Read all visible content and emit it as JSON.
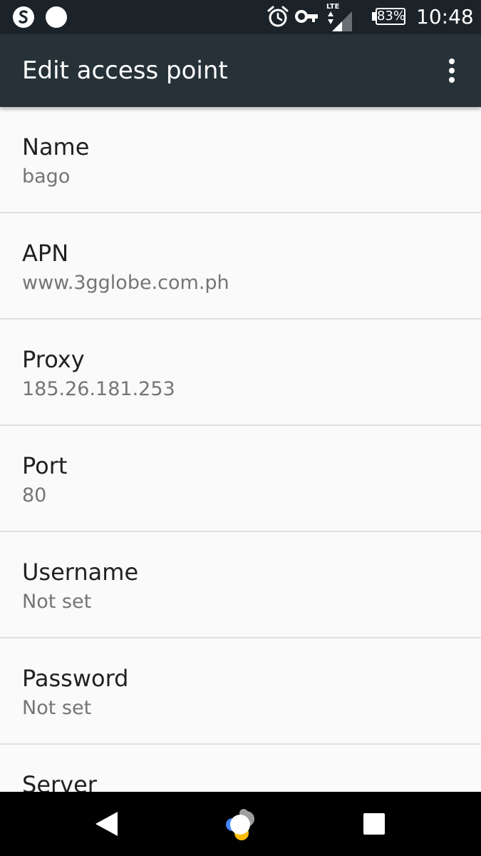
{
  "status_bar": {
    "left_icons": [
      "s-app-icon",
      "circle-app-icon"
    ],
    "right_icons": [
      "alarm-icon",
      "vpn-key-icon",
      "lte-signal-icon"
    ],
    "network_type": "LTE",
    "battery_percent": "83%",
    "time": "10:48"
  },
  "app_bar": {
    "title": "Edit access point",
    "menu_icon": "more-vert-icon"
  },
  "preferences": [
    {
      "title": "Name",
      "summary": "bago"
    },
    {
      "title": "APN",
      "summary": "www.3gglobe.com.ph"
    },
    {
      "title": "Proxy",
      "summary": "185.26.181.253"
    },
    {
      "title": "Port",
      "summary": "80"
    },
    {
      "title": "Username",
      "summary": "Not set"
    },
    {
      "title": "Password",
      "summary": "Not set"
    },
    {
      "title": "Server"
    }
  ],
  "nav_bar": {
    "back_icon": "back-triangle-icon",
    "home_icon": "assistant-home-icon",
    "recents_icon": "recents-square-icon",
    "colors": {
      "blue": "#4285f4",
      "yellow": "#fbbc05",
      "gray": "#9e9e9e"
    }
  },
  "colors": {
    "status_bar": "#1b2329",
    "app_bar": "#263238",
    "background": "#fafafa",
    "divider": "#e0e0e0",
    "title_text": "#212121",
    "summary_text": "#757575"
  }
}
